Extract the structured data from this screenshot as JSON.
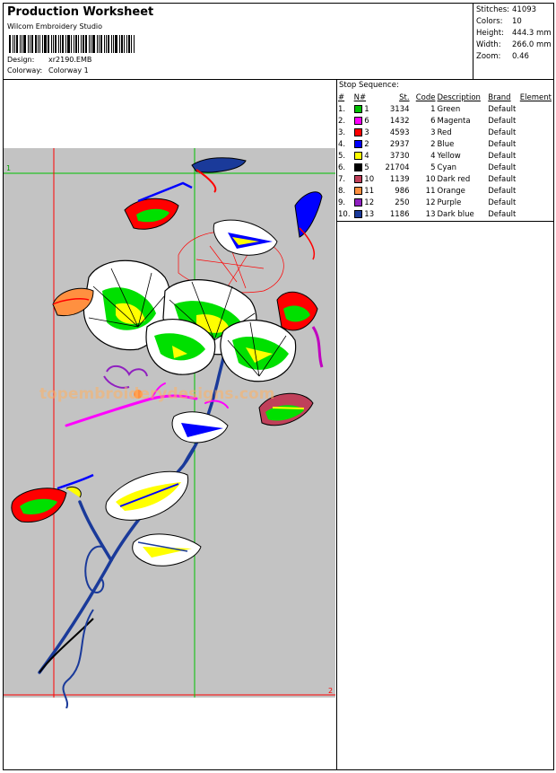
{
  "header": {
    "title": "Production Worksheet",
    "software": "Wilcom Embroidery Studio",
    "design_label": "Design:",
    "design_value": "xr2190.EMB",
    "colorway_label": "Colorway:",
    "colorway_value": "Colorway 1"
  },
  "stats": {
    "stitches_label": "Stitches:",
    "stitches_value": "41093",
    "colors_label": "Colors:",
    "colors_value": "10",
    "height_label": "Height:",
    "height_value": "444.3 mm",
    "width_label": "Width:",
    "width_value": "266.0 mm",
    "zoom_label": "Zoom:",
    "zoom_value": "0.46"
  },
  "preview": {
    "start_marker": "1",
    "end_marker": "2",
    "watermark": "topembroiderydesigns.com"
  },
  "stop_sequence": {
    "title": "Stop Sequence:",
    "columns": [
      "#",
      "N#",
      "St.",
      "Code",
      "Description",
      "Brand",
      "Element"
    ],
    "rows": [
      {
        "idx": "1.",
        "n": "1",
        "color": "#00c000",
        "st": "3134",
        "code": "1",
        "desc": "Green",
        "brand": "Default",
        "element": ""
      },
      {
        "idx": "2.",
        "n": "6",
        "color": "#ff00ff",
        "st": "1432",
        "code": "6",
        "desc": "Magenta",
        "brand": "Default",
        "element": ""
      },
      {
        "idx": "3.",
        "n": "3",
        "color": "#ff0000",
        "st": "4593",
        "code": "3",
        "desc": "Red",
        "brand": "Default",
        "element": ""
      },
      {
        "idx": "4.",
        "n": "2",
        "color": "#0000ff",
        "st": "2937",
        "code": "2",
        "desc": "Blue",
        "brand": "Default",
        "element": ""
      },
      {
        "idx": "5.",
        "n": "4",
        "color": "#ffff00",
        "st": "3730",
        "code": "4",
        "desc": "Yellow",
        "brand": "Default",
        "element": ""
      },
      {
        "idx": "6.",
        "n": "5",
        "color": "#000000",
        "st": "21704",
        "code": "5",
        "desc": "Cyan",
        "brand": "Default",
        "element": ""
      },
      {
        "idx": "7.",
        "n": "10",
        "color": "#c0405a",
        "st": "1139",
        "code": "10",
        "desc": "Dark red",
        "brand": "Default",
        "element": ""
      },
      {
        "idx": "8.",
        "n": "11",
        "color": "#ff9040",
        "st": "986",
        "code": "11",
        "desc": "Orange",
        "brand": "Default",
        "element": ""
      },
      {
        "idx": "9.",
        "n": "12",
        "color": "#9020c0",
        "st": "250",
        "code": "12",
        "desc": "Purple",
        "brand": "Default",
        "element": ""
      },
      {
        "idx": "10.",
        "n": "13",
        "color": "#1a3a9a",
        "st": "1186",
        "code": "13",
        "desc": "Dark blue",
        "brand": "Default",
        "element": ""
      }
    ]
  },
  "colors": {
    "guide_red": "#ff0000",
    "guide_green": "#00c000",
    "preview_bg": "#c3c3c3"
  }
}
